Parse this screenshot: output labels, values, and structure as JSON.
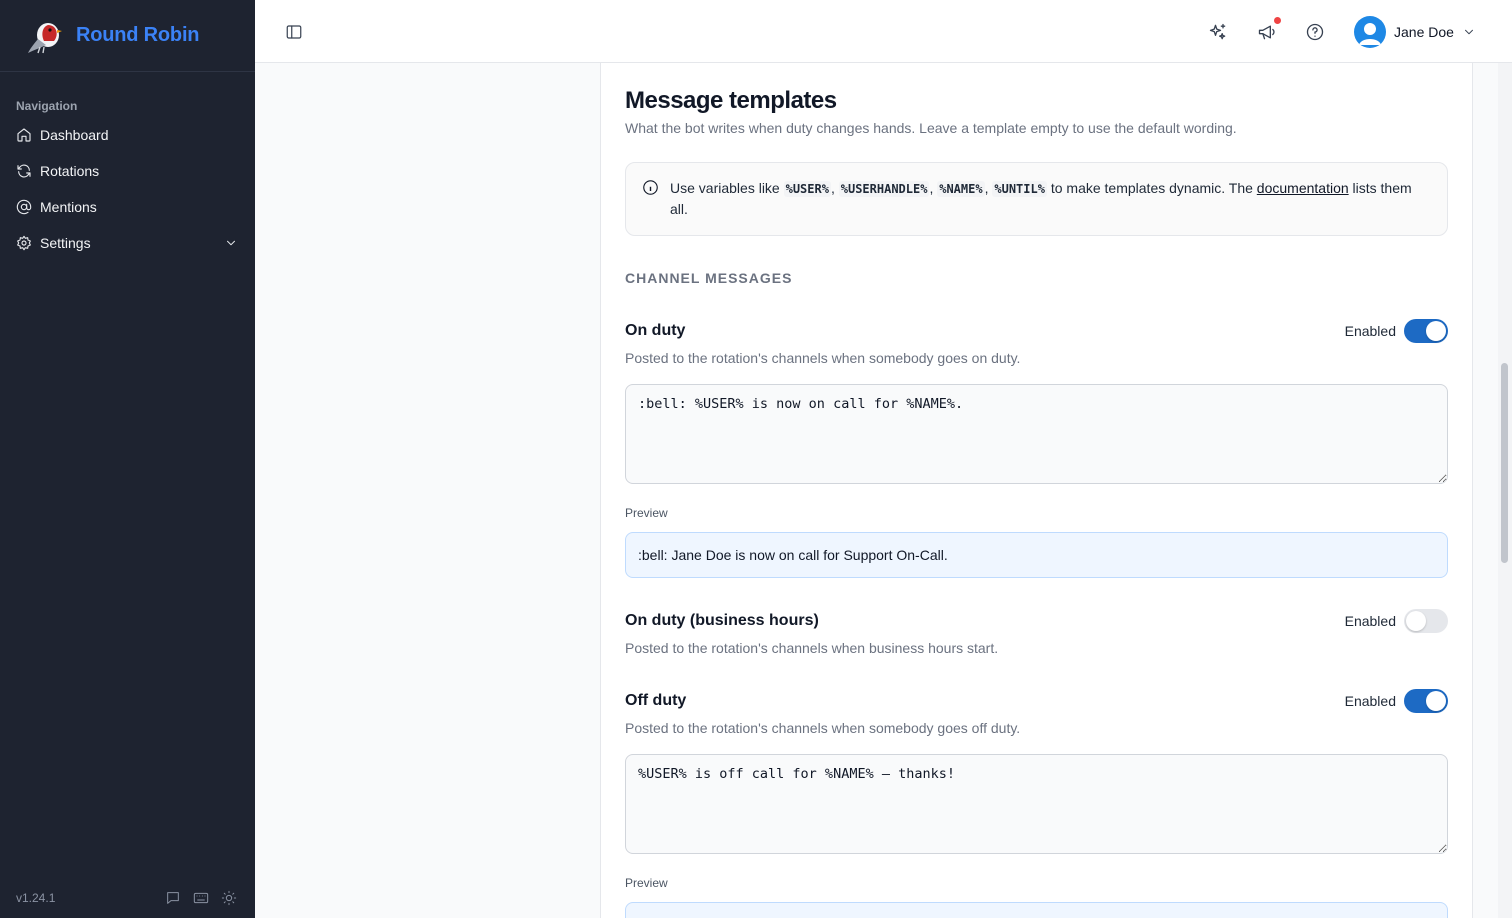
{
  "app": {
    "name": "Round Robin",
    "version": "v1.24.1"
  },
  "sidebar": {
    "nav_label": "Navigation",
    "items": [
      {
        "label": "Dashboard",
        "icon": "home-icon"
      },
      {
        "label": "Rotations",
        "icon": "refresh-icon"
      },
      {
        "label": "Mentions",
        "icon": "at-sign-icon"
      },
      {
        "label": "Settings",
        "icon": "gear-icon"
      }
    ]
  },
  "topbar": {
    "user_name": "Jane Doe"
  },
  "page": {
    "title": "Message templates",
    "subtitle": "What the bot writes when duty changes hands. Leave a template empty to use the default wording.",
    "info": {
      "prefix": "Use variables like",
      "vars": [
        "%USER%",
        "%USERHANDLE%",
        "%NAME%",
        "%UNTIL%"
      ],
      "middle": "to make templates dynamic. The",
      "link": "documentation",
      "suffix": "lists them all."
    },
    "section_heading": "CHANNEL MESSAGES",
    "enabled_label": "Enabled",
    "preview_label": "Preview",
    "templates": [
      {
        "title": "On duty",
        "description": "Posted to the rotation's channels when somebody goes on duty.",
        "enabled": true,
        "value": ":bell: %USER% is now on call for %NAME%.",
        "preview": ":bell: Jane Doe is now on call for Support On-Call."
      },
      {
        "title": "On duty (business hours)",
        "description": "Posted to the rotation's channels when business hours start.",
        "enabled": false
      },
      {
        "title": "Off duty",
        "description": "Posted to the rotation's channels when somebody goes off duty.",
        "enabled": true,
        "value": "%USER% is off call for %NAME% — thanks!",
        "preview": ""
      }
    ]
  },
  "colors": {
    "accent": "#1d6ac4",
    "brand": "#3b82f6",
    "sidebar_bg": "#1e2330",
    "notification": "#ef4444"
  }
}
